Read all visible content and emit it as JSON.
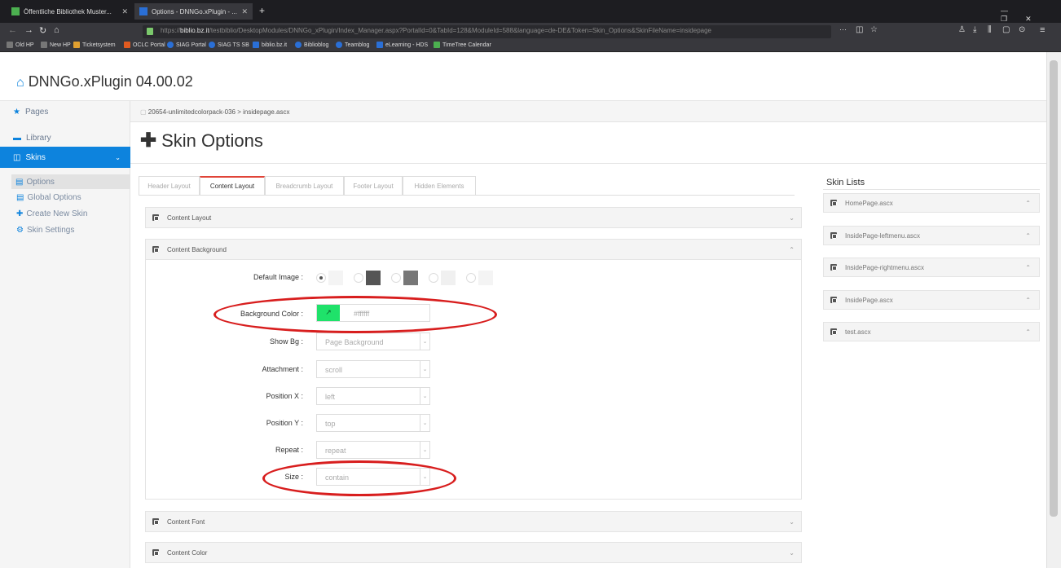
{
  "browser": {
    "tabs": [
      {
        "title": "Öffentliche Bibliothek Muster..."
      },
      {
        "title": "Options - DNNGo.xPlugin - ..."
      }
    ],
    "url_prefix": "https://",
    "url_host": "biblio.bz.it",
    "url_rest": "/testbiblio/DesktopModules/DNNGo_xPlugin/Index_Manager.aspx?PortalId=0&TabId=128&ModuleId=588&language=de-DE&Token=Skin_Options&SkinFileName=insidepage",
    "window_controls": [
      "—",
      "❐",
      "✕"
    ],
    "bookmarks": [
      "Old HP",
      "New HP",
      "Ticketsystem",
      "OCLC Portal",
      "SIAG Portal",
      "SIAG TS SB",
      "biblio.bz.it",
      "Biblioblog",
      "Teamblog",
      "eLearning - HDS",
      "TimeTree Calendar"
    ],
    "bookmark_colors": [
      "#777777",
      "#777777",
      "#e0a030",
      "#e05a20",
      "#2a6fd6",
      "#2a6fd6",
      "#2a6fd6",
      "#2a6fd6",
      "#2a6fd6",
      "#2a6fd6",
      "#4cb050"
    ]
  },
  "app": {
    "title": "DNNGo.xPlugin 04.00.02",
    "breadcrumb": "20654-unlimitedcolorpack-036 > insidepage.ascx",
    "page_title": "Skin Options",
    "accent": "#0d83dd"
  },
  "sidebar": {
    "items": [
      {
        "label": "Pages",
        "icon": "star-icon"
      },
      {
        "label": "Library",
        "icon": "image-icon"
      },
      {
        "label": "Skins",
        "icon": "skin-icon"
      }
    ],
    "subitems": [
      {
        "label": "Options"
      },
      {
        "label": "Global Options"
      },
      {
        "label": "Create New Skin"
      },
      {
        "label": "Skin Settings"
      }
    ]
  },
  "tabs": [
    "Header Layout",
    "Content Layout",
    "Breadcrumb Layout",
    "Footer Layout",
    "Hidden Elements"
  ],
  "panels": {
    "content_layout": "Content Layout",
    "content_background": "Content Background",
    "content_font": "Content Font",
    "content_color": "Content Color"
  },
  "form": {
    "default_image_label": "Default Image :",
    "background_color_label": "Background Color :",
    "background_color_value": "#ffffff",
    "background_color_chip": "#1fe26a",
    "show_bg_label": "Show Bg :",
    "show_bg_value": "Page Background",
    "attachment_label": "Attachment :",
    "attachment_value": "scroll",
    "position_x_label": "Position X :",
    "position_x_value": "left",
    "position_y_label": "Position Y :",
    "position_y_value": "top",
    "repeat_label": "Repeat :",
    "repeat_value": "repeat",
    "size_label": "Size :",
    "size_value": "contain"
  },
  "skin_lists": {
    "title": "Skin Lists",
    "items": [
      "HomePage.ascx",
      "InsidePage-leftmenu.ascx",
      "InsidePage-rightmenu.ascx",
      "InsidePage.ascx",
      "test.ascx"
    ]
  }
}
